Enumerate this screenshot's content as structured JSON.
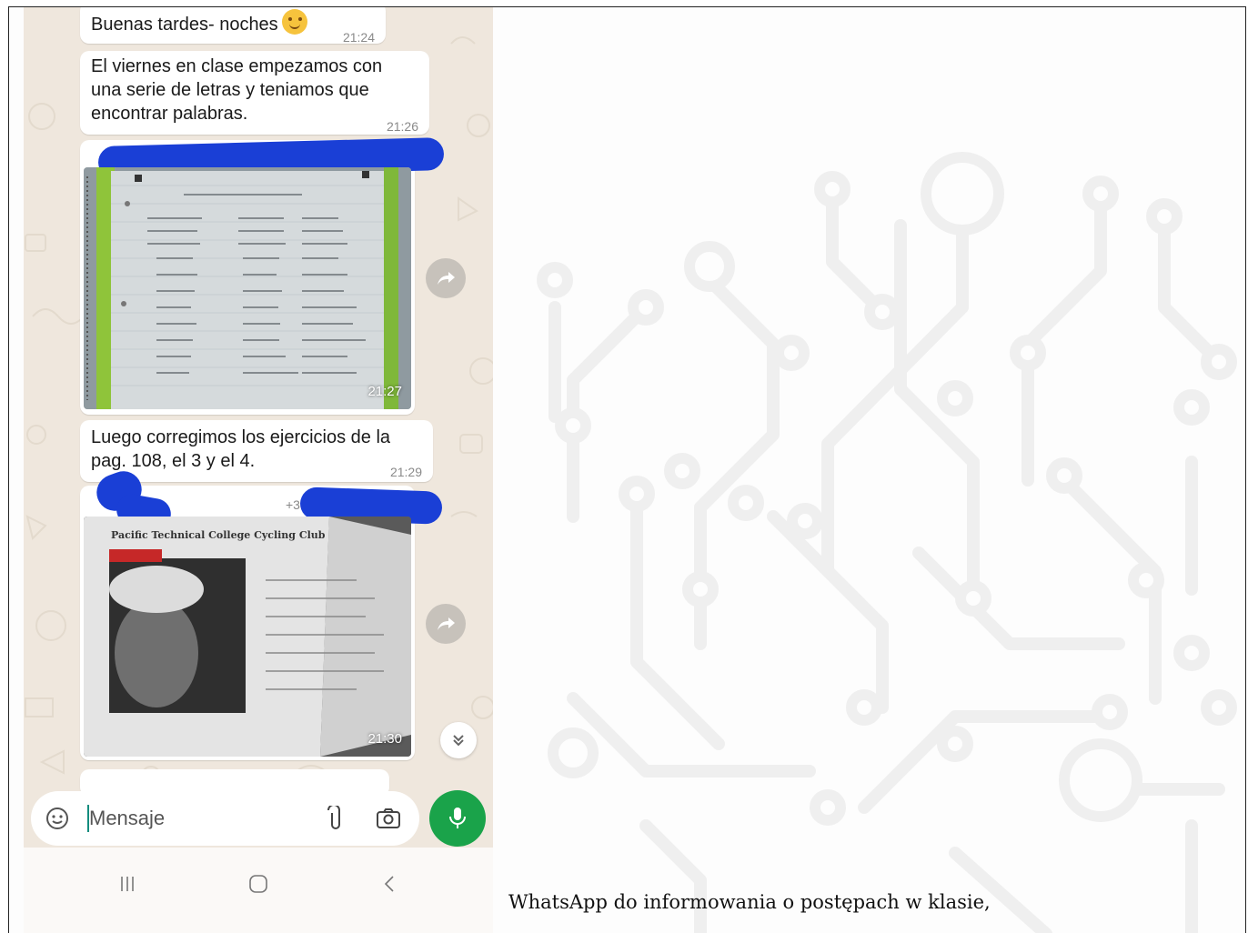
{
  "caption": "WhatsApp do informowania o postępach w klasie,",
  "chat": {
    "messages": [
      {
        "text": "Buenas tardes- noches",
        "time": "21:24",
        "emoji": "winking-smile-emoji"
      },
      {
        "text": "El viernes en clase empezamos con una serie de letras y teníamos que encontrar palabras.",
        "lines": [
          "El viernes en clase empezamos con",
          "una serie de letras y teniamos que",
          "encontrar palabras."
        ],
        "time": "21:26"
      },
      {
        "type": "image",
        "description_icon": "notebook-photo",
        "time": "21:27"
      },
      {
        "lines": [
          "Luego corregimos los ejercicios de la",
          "pag. 108, el 3 y el 4."
        ],
        "time": "21:29"
      },
      {
        "type": "image",
        "sender_extra": "+3",
        "book_header": "Pacific Technical College Cycling Club",
        "time": "21:30"
      }
    ],
    "input_placeholder": "Mensaje"
  },
  "colors": {
    "chat_bg": "#efe7dd",
    "bubble": "#ffffff",
    "mic_button": "#1aa34a",
    "redaction": "#1a3fd6"
  }
}
